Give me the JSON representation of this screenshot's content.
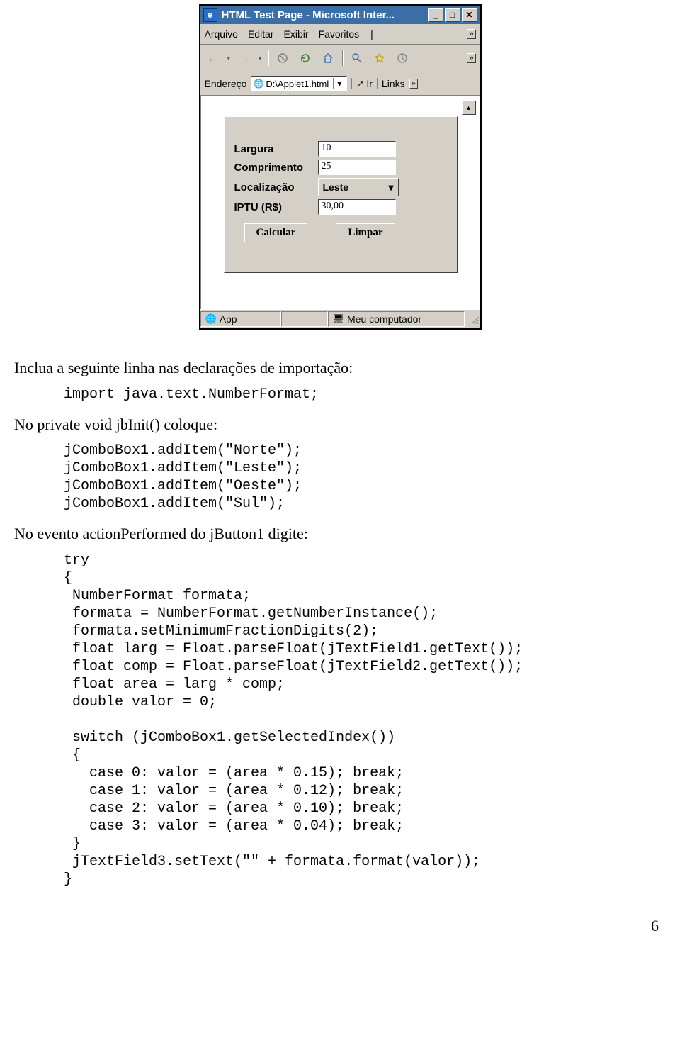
{
  "browser": {
    "title": "HTML Test Page - Microsoft Inter...",
    "menus": [
      "Arquivo",
      "Editar",
      "Exibir",
      "Favoritos"
    ],
    "menu_more": "»",
    "toolbar_more": "»",
    "address_label": "Endereço",
    "address_value": "D:\\Applet1.html",
    "go_label": "Ir",
    "links_label": "Links",
    "links_more": "»",
    "status_app": "App",
    "status_zone": "Meu computador"
  },
  "applet": {
    "largura_label": "Largura",
    "largura_value": "10",
    "comprimento_label": "Comprimento",
    "comprimento_value": "25",
    "localizacao_label": "Localização",
    "localizacao_value": "Leste",
    "iptu_label": "IPTU (R$)",
    "iptu_value": "30,00",
    "calcular_label": "Calcular",
    "limpar_label": "Limpar"
  },
  "doc": {
    "p1": "Inclua a seguinte linha nas declarações de importação:",
    "code1": "import java.text.NumberFormat;",
    "p2": "No private void jbInit() coloque:",
    "code2": "jComboBox1.addItem(\"Norte\");\njComboBox1.addItem(\"Leste\");\njComboBox1.addItem(\"Oeste\");\njComboBox1.addItem(\"Sul\");",
    "p3": "No evento actionPerformed do jButton1 digite:",
    "code3": "try\n{\n NumberFormat formata;\n formata = NumberFormat.getNumberInstance();\n formata.setMinimumFractionDigits(2);\n float larg = Float.parseFloat(jTextField1.getText());\n float comp = Float.parseFloat(jTextField2.getText());\n float area = larg * comp;\n double valor = 0;\n\n switch (jComboBox1.getSelectedIndex())\n {\n   case 0: valor = (area * 0.15); break;\n   case 1: valor = (area * 0.12); break;\n   case 2: valor = (area * 0.10); break;\n   case 3: valor = (area * 0.04); break;\n }\n jTextField3.setText(\"\" + formata.format(valor));\n}",
    "page_number": "6"
  }
}
